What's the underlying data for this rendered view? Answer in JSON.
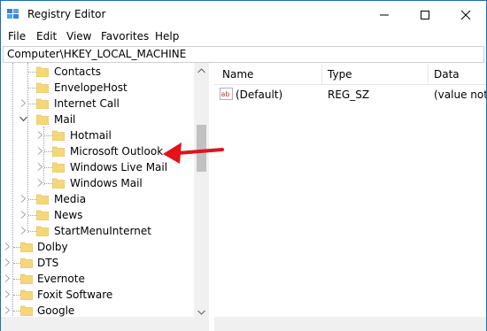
{
  "window": {
    "title": "Registry Editor"
  },
  "menu": {
    "file": "File",
    "edit": "Edit",
    "view": "View",
    "favorites": "Favorites",
    "help": "Help"
  },
  "address": "Computer\\HKEY_LOCAL_MACHINE",
  "tree": {
    "items": [
      {
        "label": "Contacts"
      },
      {
        "label": "EnvelopeHost"
      },
      {
        "label": "Internet Call"
      },
      {
        "label": "Mail"
      },
      {
        "label": "Hotmail"
      },
      {
        "label": "Microsoft Outlook"
      },
      {
        "label": "Windows Live Mail"
      },
      {
        "label": "Windows Mail"
      },
      {
        "label": "Media"
      },
      {
        "label": "News"
      },
      {
        "label": "StartMenuInternet"
      },
      {
        "label": "Dolby"
      },
      {
        "label": "DTS"
      },
      {
        "label": "Evernote"
      },
      {
        "label": "Foxit Software"
      },
      {
        "label": "Google"
      }
    ]
  },
  "values": {
    "columns": [
      "Name",
      "Type",
      "Data"
    ],
    "rows": [
      {
        "name": "(Default)",
        "type": "REG_SZ",
        "data": "(value not s"
      }
    ]
  },
  "colors": {
    "window_border": "#1a6fb5",
    "folder": "#f5d77a",
    "annotation_arrow": "#e3121b"
  }
}
